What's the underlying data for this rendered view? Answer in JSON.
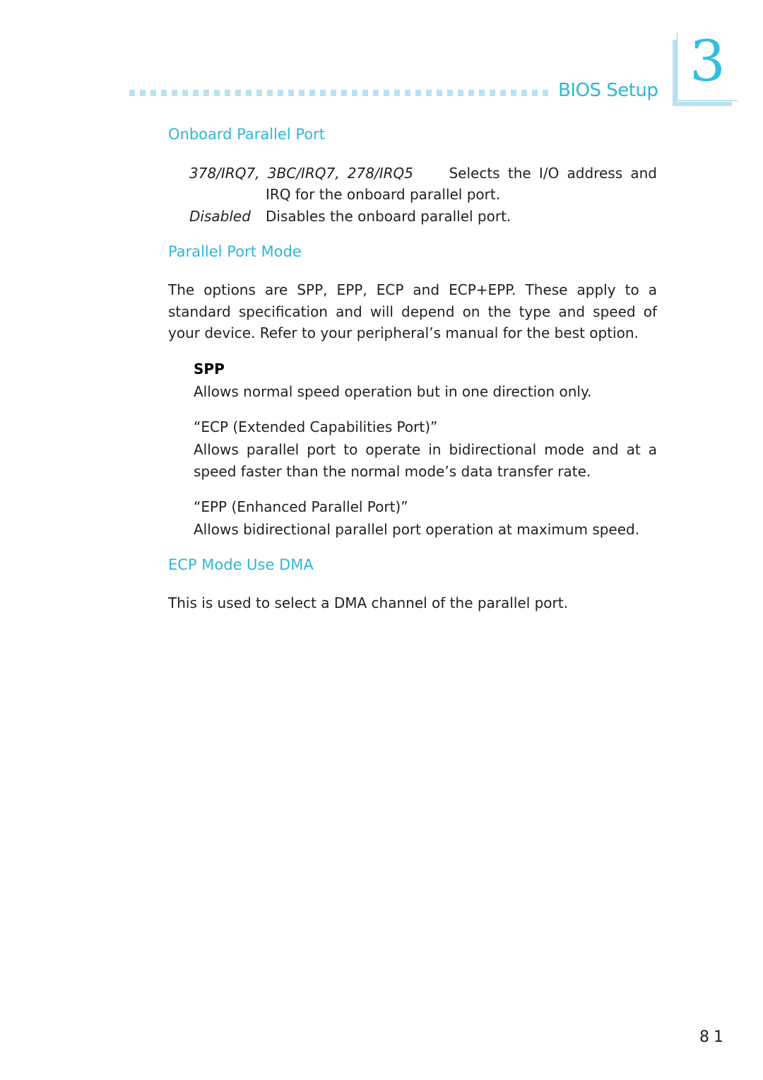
{
  "header": {
    "section_title": "BIOS Setup",
    "chapter_number": "3",
    "accent_color": "#2fb6d8",
    "light_accent_color": "#b9e2f1"
  },
  "sections": {
    "onboard_parallel_port": {
      "heading": "Onboard Parallel Port",
      "options": [
        {
          "term": "378/IRQ7, 3BC/IRQ7, 278/IRQ5",
          "desc_line1": "Selects the I/O address and",
          "desc_line2": "IRQ for the onboard parallel port."
        },
        {
          "term": "Disabled",
          "desc_line1": "Disables the onboard parallel port."
        }
      ]
    },
    "parallel_port_mode": {
      "heading": "Parallel Port Mode",
      "body_lines": [
        "The options are SPP, EPP, ECP and ECP+EPP. These apply to a",
        "standard specification and will depend on the type and speed of",
        "your device. Refer to your peripheral’s manual for the best option."
      ],
      "modes": [
        {
          "title": "SPP",
          "lines": [
            "Allows normal speed operation but in one direction only."
          ]
        },
        {
          "title": "“ECP (Extended Capabilities Port)”",
          "lines": [
            "Allows parallel port to operate in bidirectional mode and at a",
            "speed faster than the normal mode’s data transfer rate."
          ]
        },
        {
          "title": "“EPP (Enhanced Parallel Port)”",
          "lines": [
            "Allows bidirectional parallel port operation at maximum speed."
          ]
        }
      ]
    },
    "ecp_mode_use_dma": {
      "heading": "ECP Mode Use DMA",
      "body": "This is used to select a DMA channel of the parallel port."
    }
  },
  "footer": {
    "page_number": "81"
  }
}
